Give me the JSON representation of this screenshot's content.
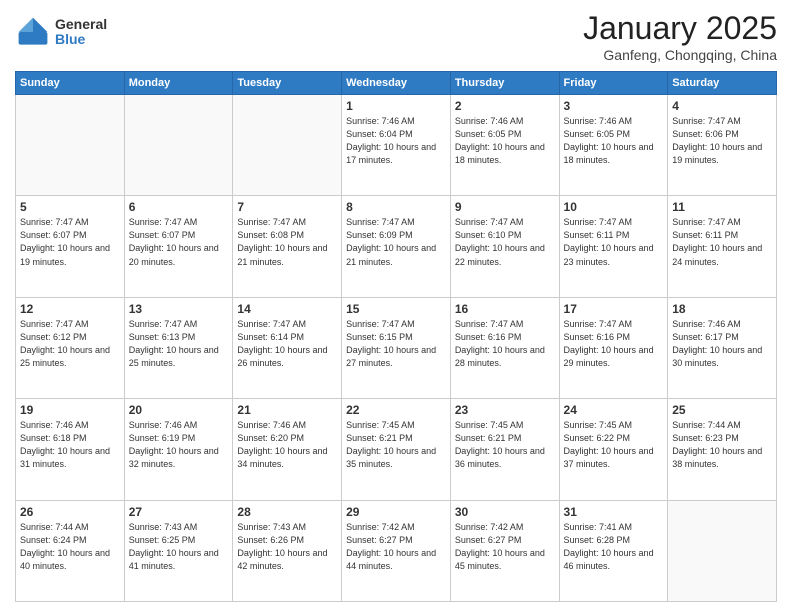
{
  "logo": {
    "general": "General",
    "blue": "Blue"
  },
  "header": {
    "month": "January 2025",
    "location": "Ganfeng, Chongqing, China"
  },
  "weekdays": [
    "Sunday",
    "Monday",
    "Tuesday",
    "Wednesday",
    "Thursday",
    "Friday",
    "Saturday"
  ],
  "weeks": [
    [
      {
        "day": "",
        "sunrise": "",
        "sunset": "",
        "daylight": ""
      },
      {
        "day": "",
        "sunrise": "",
        "sunset": "",
        "daylight": ""
      },
      {
        "day": "",
        "sunrise": "",
        "sunset": "",
        "daylight": ""
      },
      {
        "day": "1",
        "sunrise": "Sunrise: 7:46 AM",
        "sunset": "Sunset: 6:04 PM",
        "daylight": "Daylight: 10 hours and 17 minutes."
      },
      {
        "day": "2",
        "sunrise": "Sunrise: 7:46 AM",
        "sunset": "Sunset: 6:05 PM",
        "daylight": "Daylight: 10 hours and 18 minutes."
      },
      {
        "day": "3",
        "sunrise": "Sunrise: 7:46 AM",
        "sunset": "Sunset: 6:05 PM",
        "daylight": "Daylight: 10 hours and 18 minutes."
      },
      {
        "day": "4",
        "sunrise": "Sunrise: 7:47 AM",
        "sunset": "Sunset: 6:06 PM",
        "daylight": "Daylight: 10 hours and 19 minutes."
      }
    ],
    [
      {
        "day": "5",
        "sunrise": "Sunrise: 7:47 AM",
        "sunset": "Sunset: 6:07 PM",
        "daylight": "Daylight: 10 hours and 19 minutes."
      },
      {
        "day": "6",
        "sunrise": "Sunrise: 7:47 AM",
        "sunset": "Sunset: 6:07 PM",
        "daylight": "Daylight: 10 hours and 20 minutes."
      },
      {
        "day": "7",
        "sunrise": "Sunrise: 7:47 AM",
        "sunset": "Sunset: 6:08 PM",
        "daylight": "Daylight: 10 hours and 21 minutes."
      },
      {
        "day": "8",
        "sunrise": "Sunrise: 7:47 AM",
        "sunset": "Sunset: 6:09 PM",
        "daylight": "Daylight: 10 hours and 21 minutes."
      },
      {
        "day": "9",
        "sunrise": "Sunrise: 7:47 AM",
        "sunset": "Sunset: 6:10 PM",
        "daylight": "Daylight: 10 hours and 22 minutes."
      },
      {
        "day": "10",
        "sunrise": "Sunrise: 7:47 AM",
        "sunset": "Sunset: 6:11 PM",
        "daylight": "Daylight: 10 hours and 23 minutes."
      },
      {
        "day": "11",
        "sunrise": "Sunrise: 7:47 AM",
        "sunset": "Sunset: 6:11 PM",
        "daylight": "Daylight: 10 hours and 24 minutes."
      }
    ],
    [
      {
        "day": "12",
        "sunrise": "Sunrise: 7:47 AM",
        "sunset": "Sunset: 6:12 PM",
        "daylight": "Daylight: 10 hours and 25 minutes."
      },
      {
        "day": "13",
        "sunrise": "Sunrise: 7:47 AM",
        "sunset": "Sunset: 6:13 PM",
        "daylight": "Daylight: 10 hours and 25 minutes."
      },
      {
        "day": "14",
        "sunrise": "Sunrise: 7:47 AM",
        "sunset": "Sunset: 6:14 PM",
        "daylight": "Daylight: 10 hours and 26 minutes."
      },
      {
        "day": "15",
        "sunrise": "Sunrise: 7:47 AM",
        "sunset": "Sunset: 6:15 PM",
        "daylight": "Daylight: 10 hours and 27 minutes."
      },
      {
        "day": "16",
        "sunrise": "Sunrise: 7:47 AM",
        "sunset": "Sunset: 6:16 PM",
        "daylight": "Daylight: 10 hours and 28 minutes."
      },
      {
        "day": "17",
        "sunrise": "Sunrise: 7:47 AM",
        "sunset": "Sunset: 6:16 PM",
        "daylight": "Daylight: 10 hours and 29 minutes."
      },
      {
        "day": "18",
        "sunrise": "Sunrise: 7:46 AM",
        "sunset": "Sunset: 6:17 PM",
        "daylight": "Daylight: 10 hours and 30 minutes."
      }
    ],
    [
      {
        "day": "19",
        "sunrise": "Sunrise: 7:46 AM",
        "sunset": "Sunset: 6:18 PM",
        "daylight": "Daylight: 10 hours and 31 minutes."
      },
      {
        "day": "20",
        "sunrise": "Sunrise: 7:46 AM",
        "sunset": "Sunset: 6:19 PM",
        "daylight": "Daylight: 10 hours and 32 minutes."
      },
      {
        "day": "21",
        "sunrise": "Sunrise: 7:46 AM",
        "sunset": "Sunset: 6:20 PM",
        "daylight": "Daylight: 10 hours and 34 minutes."
      },
      {
        "day": "22",
        "sunrise": "Sunrise: 7:45 AM",
        "sunset": "Sunset: 6:21 PM",
        "daylight": "Daylight: 10 hours and 35 minutes."
      },
      {
        "day": "23",
        "sunrise": "Sunrise: 7:45 AM",
        "sunset": "Sunset: 6:21 PM",
        "daylight": "Daylight: 10 hours and 36 minutes."
      },
      {
        "day": "24",
        "sunrise": "Sunrise: 7:45 AM",
        "sunset": "Sunset: 6:22 PM",
        "daylight": "Daylight: 10 hours and 37 minutes."
      },
      {
        "day": "25",
        "sunrise": "Sunrise: 7:44 AM",
        "sunset": "Sunset: 6:23 PM",
        "daylight": "Daylight: 10 hours and 38 minutes."
      }
    ],
    [
      {
        "day": "26",
        "sunrise": "Sunrise: 7:44 AM",
        "sunset": "Sunset: 6:24 PM",
        "daylight": "Daylight: 10 hours and 40 minutes."
      },
      {
        "day": "27",
        "sunrise": "Sunrise: 7:43 AM",
        "sunset": "Sunset: 6:25 PM",
        "daylight": "Daylight: 10 hours and 41 minutes."
      },
      {
        "day": "28",
        "sunrise": "Sunrise: 7:43 AM",
        "sunset": "Sunset: 6:26 PM",
        "daylight": "Daylight: 10 hours and 42 minutes."
      },
      {
        "day": "29",
        "sunrise": "Sunrise: 7:42 AM",
        "sunset": "Sunset: 6:27 PM",
        "daylight": "Daylight: 10 hours and 44 minutes."
      },
      {
        "day": "30",
        "sunrise": "Sunrise: 7:42 AM",
        "sunset": "Sunset: 6:27 PM",
        "daylight": "Daylight: 10 hours and 45 minutes."
      },
      {
        "day": "31",
        "sunrise": "Sunrise: 7:41 AM",
        "sunset": "Sunset: 6:28 PM",
        "daylight": "Daylight: 10 hours and 46 minutes."
      },
      {
        "day": "",
        "sunrise": "",
        "sunset": "",
        "daylight": ""
      }
    ]
  ]
}
